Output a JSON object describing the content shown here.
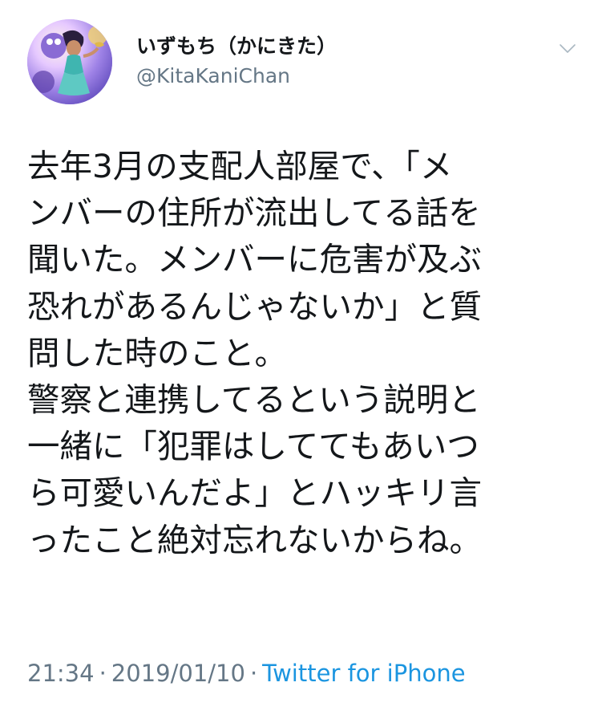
{
  "tweet": {
    "author": {
      "display_name": "いずもち（かにきた）",
      "handle": "@KitaKaniChan",
      "avatar_icon": "avatar-illustration"
    },
    "menu_icon": "chevron-down-icon",
    "text_lines": [
      "去年3月の支配人部屋で、「メ",
      "ンバーの住所が流出してる話を",
      "聞いた。メンバーに危害が及ぶ",
      "恐れがあるんじゃないか」と質",
      "問した時のこと。",
      "警察と連携してるという説明と",
      "一緒に「犯罪はしててもあいつ",
      "ら可愛いんだよ」とハッキリ言",
      "ったこと絶対忘れないからね。"
    ],
    "time": "21:34",
    "separator": "·",
    "date": "2019/01/10",
    "source": "Twitter for iPhone"
  },
  "colors": {
    "text": "#14171a",
    "secondary": "#657786",
    "link": "#1b95e0",
    "background": "#ffffff"
  }
}
